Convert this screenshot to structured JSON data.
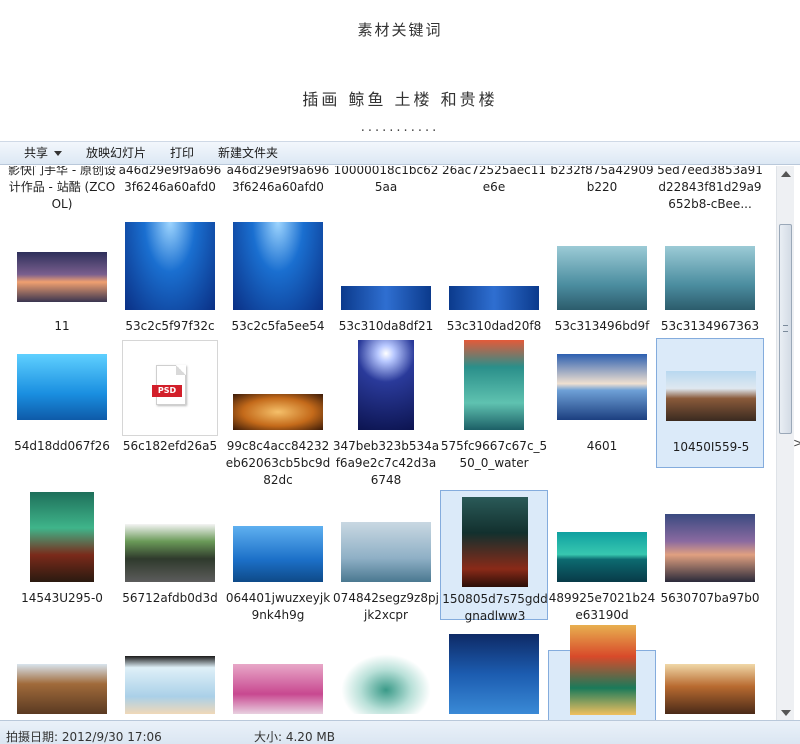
{
  "header": {
    "title": "素材关键词",
    "subtitle": "插画 鲸鱼 土楼 和贵楼",
    "dots": "..........."
  },
  "toolbar": {
    "share_label": "共享",
    "slideshow_label": "放映幻灯片",
    "print_label": "打印",
    "new_folder_label": "新建文件夹"
  },
  "files": [
    {
      "name": "影快门手华 - 原创设计作品 - 站酷 (ZCOOL)",
      "thumb": "none"
    },
    {
      "name": "a46d29e9f9a6963f6246a60afd0",
      "thumb": "none"
    },
    {
      "name": "a46d29e9f9a6963f6246a60afd0",
      "thumb": "none"
    },
    {
      "name": "10000018c1bc625aa",
      "thumb": "none"
    },
    {
      "name": "26ac72525aec11e6e",
      "thumb": "none"
    },
    {
      "name": "b232f875a42909b220",
      "thumb": "none"
    },
    {
      "name": "5ed7eed3853a91d22843f81d29a9652b8-cBee...",
      "thumb": "none"
    },
    {
      "name": "11",
      "thumb": "sunset"
    },
    {
      "name": "53c2c5f97f32c",
      "thumb": "dolphins"
    },
    {
      "name": "53c2c5fa5ee54",
      "thumb": "dolphins"
    },
    {
      "name": "53c310da8df21",
      "thumb": "banner"
    },
    {
      "name": "53c310dad20f8",
      "thumb": "banner"
    },
    {
      "name": "53c313496bd9f",
      "thumb": "teal-whale"
    },
    {
      "name": "53c3134967363",
      "thumb": "teal-whale"
    },
    {
      "name": "54d18dd067f26",
      "thumb": "dolphin-cartoon"
    },
    {
      "name": "56c182efd26a5",
      "thumb": "psd"
    },
    {
      "name": "99c8c4acc84232eb62063cb5bc9d82dc",
      "thumb": "amber"
    },
    {
      "name": "347beb323b534af6a9e2c7c42d3a6748",
      "thumb": "moon-dolphin"
    },
    {
      "name": "575fc9667c67c_550_0_water",
      "thumb": "poster-teal"
    },
    {
      "name": "4601",
      "thumb": "sky-sea"
    },
    {
      "name": "10450I559-5",
      "thumb": "tulou-wide",
      "selected": true
    },
    {
      "name": "14543U295-0",
      "thumb": "green-arena"
    },
    {
      "name": "56712afdb0d3d",
      "thumb": "roof-trees"
    },
    {
      "name": "064401jwuzxeyjk9nk4h9g",
      "thumb": "dolphin-water"
    },
    {
      "name": "074842segz9z8pjjk2xcpr",
      "thumb": "cloud-whale"
    },
    {
      "name": "150805d7s75gddgnadlww3",
      "thumb": "dark-poster",
      "selected": true
    },
    {
      "name": "489925e7021b24e63190d",
      "thumb": "sea-horizon"
    },
    {
      "name": "5630707ba97b0",
      "thumb": "dusk-whale"
    },
    {
      "name": "",
      "thumb": "tulou-ring"
    },
    {
      "name": "",
      "thumb": "sky-whale"
    },
    {
      "name": "",
      "thumb": "pink-sky"
    },
    {
      "name": "",
      "thumb": "watercolor-whale"
    },
    {
      "name": "",
      "thumb": "blue-poster"
    },
    {
      "name": "",
      "thumb": "red-poster",
      "selected": true
    },
    {
      "name": "",
      "thumb": "warm-room"
    }
  ],
  "status": {
    "date": "拍摄日期: 2012/9/30 17:06",
    "size": "大小: 4.20 MB"
  },
  "colors": {
    "toolbar_top": "#f3f7fc",
    "toolbar_bottom": "#dde8f4",
    "selection_fill": "#dbeaf9",
    "selection_border": "#84acdd"
  }
}
